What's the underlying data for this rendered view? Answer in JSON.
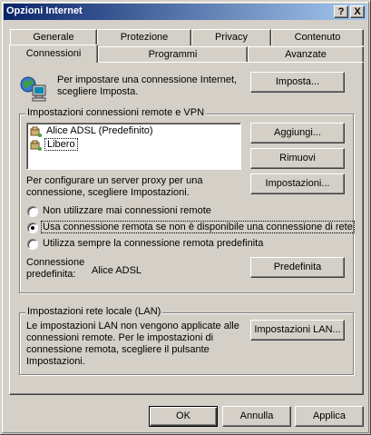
{
  "window": {
    "title": "Opzioni Internet",
    "help_button": "?",
    "close_button": "X"
  },
  "tabs_back": [
    "Generale",
    "Protezione",
    "Privacy",
    "Contenuto"
  ],
  "tabs_front": [
    "Connessioni",
    "Programmi",
    "Avanzate"
  ],
  "active_tab": "Connessioni",
  "setup": {
    "text": "Per impostare una connessione Internet, scegliere Imposta.",
    "button": "Imposta..."
  },
  "dialup": {
    "legend": "Impostazioni connessioni remote e VPN",
    "connections": [
      "Alice ADSL (Predefinito)",
      "Libero"
    ],
    "selected_index": 1,
    "add_button": "Aggiungi...",
    "remove_button": "Rimuovi",
    "settings_text": "Per configurare un server proxy per una connessione, scegliere Impostazioni.",
    "settings_button": "Impostazioni...",
    "radio_options": [
      "Non utilizzare mai connessioni remote",
      "Usa connessione remota se non è disponibile una connessione di rete",
      "Utilizza sempre la connessione remota predefinita"
    ],
    "selected_radio": 1,
    "default_label": "Connessione predefinita:",
    "default_value": "Alice ADSL",
    "default_button": "Predefinita"
  },
  "lan": {
    "legend": "Impostazioni rete locale (LAN)",
    "text": "Le impostazioni LAN non vengono applicate alle connessioni remote. Per le impostazioni di connessione remota, scegliere il pulsante Impostazioni.",
    "button": "Impostazioni LAN..."
  },
  "footer": {
    "ok": "OK",
    "cancel": "Annulla",
    "apply": "Applica"
  }
}
